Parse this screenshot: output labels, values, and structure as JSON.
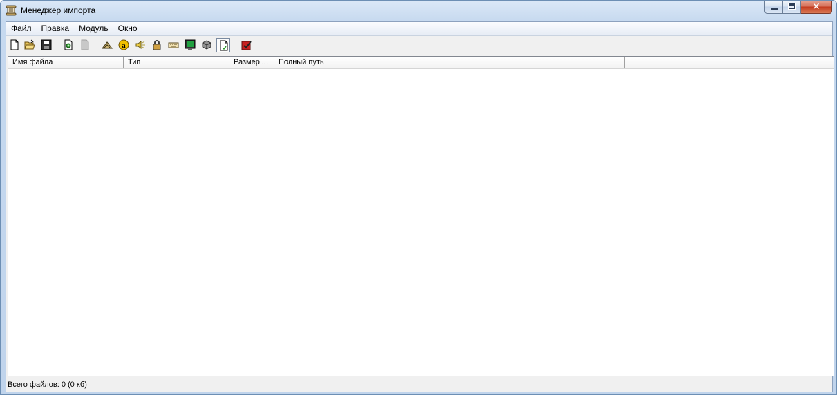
{
  "window": {
    "title": "Менеджер импорта"
  },
  "menu": {
    "items": [
      "Файл",
      "Правка",
      "Модуль",
      "Окно"
    ]
  },
  "toolbar": {
    "buttons": [
      {
        "icon": "new-document-icon"
      },
      {
        "icon": "open-folder-icon"
      },
      {
        "icon": "save-disk-icon"
      },
      {
        "icon": "add-file-icon"
      },
      {
        "icon": "remove-file-icon"
      },
      {
        "icon": "terrain-icon"
      },
      {
        "icon": "font-icon"
      },
      {
        "icon": "speaker-icon"
      },
      {
        "icon": "lock-icon"
      },
      {
        "icon": "keyboard-icon"
      },
      {
        "icon": "monitor-icon"
      },
      {
        "icon": "box-icon"
      },
      {
        "icon": "file-import-icon"
      },
      {
        "icon": "checklist-icon"
      }
    ]
  },
  "list": {
    "columns": [
      "Имя файла",
      "Тип",
      "Размер ...",
      "Полный путь",
      ""
    ],
    "rows": []
  },
  "status": {
    "text": "Всего файлов: 0 (0 кб)"
  }
}
